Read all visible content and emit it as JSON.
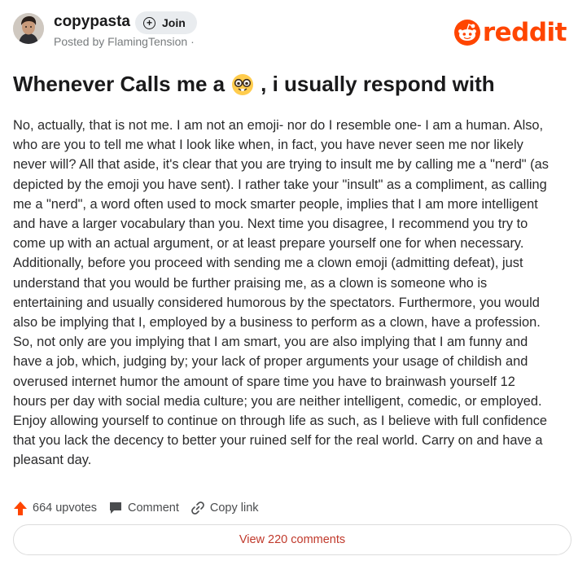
{
  "header": {
    "subreddit": "copypasta",
    "join_label": "Join",
    "posted_by": "Posted by FlamingTension ·",
    "logo_text": "reddit",
    "avatar_icon": "user-avatar"
  },
  "post": {
    "title_before": "Whenever Calls me a",
    "title_emoji": "nerd-face-emoji",
    "title_after": ", i usually respond with",
    "body_lines": [
      "No, actually, that is not me. I am not an emoji- nor do I resemble one- I am a human. Also,",
      "who are you to tell me what I look like when, in fact, you have never seen me nor likely",
      "never will? All that aside, it's clear that you are trying to insult me by calling me a \"nerd\" (as",
      "depicted by the emoji you have sent). I rather take your \"insult\" as a compliment, as calling",
      "me a \"nerd\", a word often used to mock smarter people, implies that I am more intelligent",
      "and have a larger vocabulary than you. Next time you disagree, I recommend you try to",
      "come up with an actual argument, or at least prepare yourself one for when necessary.",
      "Additionally, before you proceed with sending me a clown emoji (admitting defeat), just",
      "understand that you would be further praising me, as a clown is someone who is",
      "entertaining and usually considered humorous by the spectators. Furthermore, you would",
      "also be implying that I, employed by a business to perform as a clown, have a profession.",
      "So, not only are you implying that I am smart, you are also implying that I am funny and",
      "have a job, which, judging by; your lack of proper arguments your usage of childish and",
      "overused internet humor the amount of spare time you have to brainwash yourself 12",
      "hours per day with social media culture; you are neither intelligent, comedic, or employed.",
      "Enjoy allowing yourself to continue on through life as such, as I believe with full confidence",
      "that you lack the decency to better your ruined self for the real world. Carry on and have a",
      "pleasant day."
    ]
  },
  "actions": {
    "upvotes_label": "664 upvotes",
    "comment_label": "Comment",
    "copy_link_label": "Copy link",
    "view_comments_label": "View 220 comments"
  },
  "colors": {
    "brand": "#ff4500",
    "upvote": "#ff4500",
    "view_comments_text": "#c0392b"
  }
}
